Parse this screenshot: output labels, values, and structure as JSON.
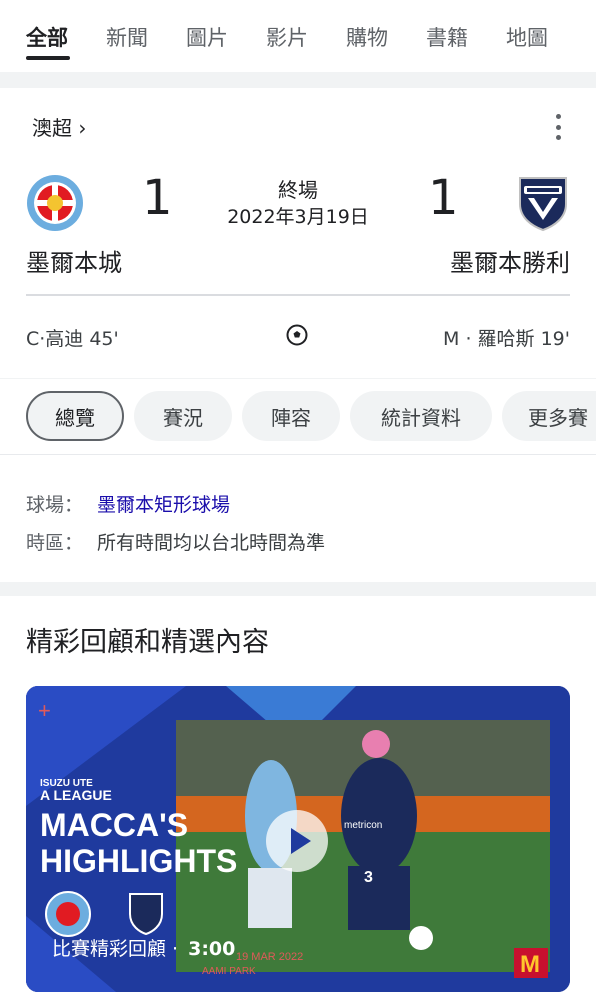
{
  "tabs": [
    "全部",
    "新聞",
    "圖片",
    "影片",
    "購物",
    "書籍",
    "地圖"
  ],
  "match": {
    "league": "澳超",
    "league_chevron": "›",
    "status": "終場",
    "date": "2022年3月19日",
    "home": {
      "name": "墨爾本城",
      "score": "1",
      "scorer": "C·高迪 45'"
    },
    "away": {
      "name": "墨爾本勝利",
      "score": "1",
      "scorer": "M · 羅哈斯 19'"
    }
  },
  "chips": [
    "總覽",
    "賽況",
    "陣容",
    "統計資料",
    "更多賽"
  ],
  "info": {
    "venue_label": "球場：",
    "venue_value": "墨爾本矩形球場",
    "timezone_label": "時區：",
    "timezone_value": "所有時間均以台北時間為準"
  },
  "highlights": {
    "title": "精彩回顧和精選內容",
    "video": {
      "caption": "比賽精彩回顧 ·",
      "duration": "3:00",
      "thumb_league": "A LEAGUE",
      "thumb_sponsor": "ISUZU UTE",
      "thumb_line1": "MACCA'S",
      "thumb_line2": "HIGHLIGHTS",
      "thumb_date": "19 MAR 2022",
      "thumb_venue": "AAMI PARK",
      "thumb_jersey": "3",
      "thumb_shirt_sponsor": "metricon"
    }
  },
  "colors": {
    "link": "#1a0dab",
    "home_primary": "#6caddf",
    "away_primary": "#1b2a5b",
    "thumb_bg": "#1f3a9e"
  }
}
